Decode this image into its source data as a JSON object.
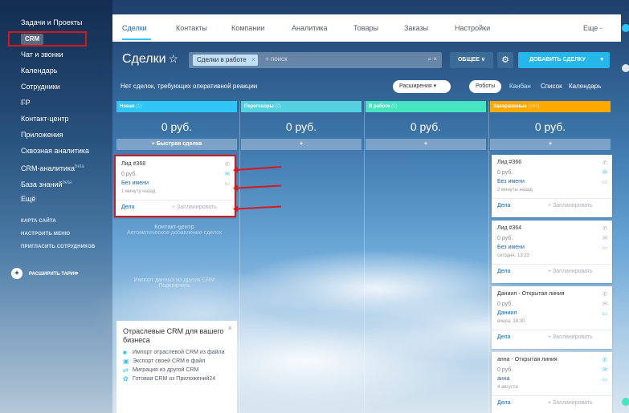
{
  "colors": {
    "accent": "#2fc6f6",
    "highlight_red": "#d81818",
    "new_col": "#2fc6f6",
    "negotiation_col": "#55d0e0",
    "in_work_col": "#47e4c2",
    "done_col": "#ffa900"
  },
  "sidebar": {
    "items": [
      "Задачи и Проекты",
      "CRM",
      "Чат и звонки",
      "Календарь",
      "Сотрудники",
      "FP",
      "Контакт-центр",
      "Приложения",
      "Сквозная аналитика",
      "CRM-аналитика",
      "База знаний",
      "Ещё"
    ],
    "beta": "beta",
    "small": [
      "КАРТА САЙТА",
      "НАСТРОИТЬ МЕНЮ",
      "ПРИГЛАСИТЬ СОТРУДНИКОВ"
    ],
    "upgrade": "РАСШИРИТЬ ТАРИФ"
  },
  "topnav": {
    "tabs": [
      "Сделки",
      "Контакты",
      "Компании",
      "Аналитика",
      "Товары",
      "Заказы",
      "Настройки"
    ],
    "more": "Еще -"
  },
  "toolbar": {
    "title": "Сделки",
    "star": "☆",
    "filter_chip": "Сделки в работе",
    "filter_placeholder": "+ поиск",
    "general_label": "ОБЩЕЕ ∨",
    "add_label": "ДОБАВИТЬ СДЕЛКУ"
  },
  "subbar": {
    "message": "Нет сделок, требующих оперативной реакции",
    "extensions": "Расширения",
    "robots": "Роботы",
    "views": [
      "Канбан",
      "Список",
      "Календарь"
    ]
  },
  "columns": [
    {
      "name": "Новая",
      "count": "(1)",
      "sum": "0 руб."
    },
    {
      "name": "Переговоры",
      "count": "(0)",
      "sum": "0 руб."
    },
    {
      "name": "В работе",
      "count": "(0)",
      "sum": "0 руб."
    },
    {
      "name": "Завершенные",
      "count": "(164)",
      "sum": "0 руб."
    }
  ],
  "quick_deal": "+ Быстрая сделка",
  "quick_plus": "+",
  "cards": [
    {
      "title": "Лид #368",
      "sum": "0 руб.",
      "contact": "Без имени",
      "date": "1 минуту назад",
      "deals": "Дела",
      "plan": "+ Запланировать"
    },
    {
      "title": "Лид #366",
      "sum": "0 руб.",
      "contact": "Без имени",
      "date": "2 минуты назад",
      "deals": "Дела",
      "plan": "+ Запланировать"
    },
    {
      "title": "Лид #364",
      "sum": "0 руб.",
      "contact": "Без имени",
      "date": "сегодня, 13:23",
      "deals": "Дела",
      "plan": "+ Запланировать"
    },
    {
      "title": "Даниил - Открытая линия",
      "sum": "0 руб.",
      "contact": "Даниил",
      "date": "вчера, 18:30",
      "deals": "Дела",
      "plan": "+ Запланировать"
    },
    {
      "title": "анна - Открытая линия",
      "sum": "0 руб.",
      "contact": "анна",
      "date": "4 августа",
      "deals": "Дела",
      "plan": "+ Запланировать"
    }
  ],
  "faded": {
    "line1": "Контакт-центр",
    "line2": "Автоматическое добавление сделок",
    "line3": "Импорт данных из других CRM",
    "line4": "Подключить"
  },
  "promo": {
    "heading": "Отраслевые CRM для вашего бизнеса",
    "items": [
      "Импорт отраслевой CRM из файла",
      "Экспорт своей CRM в файл",
      "Миграция из другой CRM",
      "Готовая CRM из Приложений24"
    ]
  }
}
